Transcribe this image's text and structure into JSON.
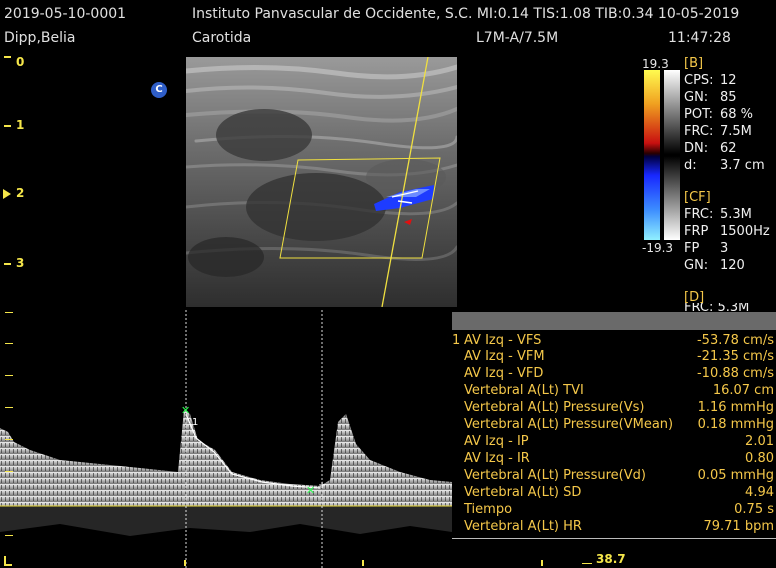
{
  "header": {
    "patient_id": "2019-05-10-0001",
    "institution_info": "Instituto Panvascular de Occidente, S.C. MI:0.14  TIS:1.08  TIB:0.34  10-05-2019",
    "patient_name": "Dipp,Belia",
    "exam": "Carotida",
    "probe": "L7M-A/7.5M",
    "time": "11:47:28"
  },
  "depth_scale": [
    "0",
    "1",
    "2",
    "3"
  ],
  "mode_badge": "C",
  "colorbar": {
    "top": "19.3",
    "bottom": "-19.3"
  },
  "b_params": {
    "title": "[B]",
    "items": [
      {
        "k": "CPS:",
        "v": "12"
      },
      {
        "k": "GN:",
        "v": "85"
      },
      {
        "k": "POT:",
        "v": "68 %"
      },
      {
        "k": "FRC:",
        "v": "7.5M"
      },
      {
        "k": "DN:",
        "v": "62"
      },
      {
        "k": "d:",
        "v": "3.7 cm"
      }
    ]
  },
  "cf_params": {
    "title": "[CF]",
    "items": [
      {
        "k": "FRC:",
        "v": "5.3M"
      },
      {
        "k": "FRP",
        "v": "1500Hz"
      },
      {
        "k": "FP",
        "v": "3"
      },
      {
        "k": "GN:",
        "v": "120"
      }
    ]
  },
  "d_params": {
    "title": "[D]",
    "partial": "FRC: 5.3M"
  },
  "measurements": [
    {
      "num": "1",
      "label": "AV Izq - VFS",
      "value": "-53.78 cm/s"
    },
    {
      "num": "",
      "label": "AV Izq - VFM",
      "value": "-21.35 cm/s"
    },
    {
      "num": "",
      "label": "AV Izq - VFD",
      "value": "-10.88 cm/s"
    },
    {
      "num": "",
      "label": "Vertebral A(Lt) TVI",
      "value": "16.07 cm"
    },
    {
      "num": "",
      "label": "Vertebral A(Lt) Pressure(Vs)",
      "value": "1.16 mmHg"
    },
    {
      "num": "",
      "label": "Vertebral A(Lt) Pressure(VMean)",
      "value": "0.18 mmHg"
    },
    {
      "num": "",
      "label": "AV Izq - IP",
      "value": "2.01"
    },
    {
      "num": "",
      "label": "AV Izq - IR",
      "value": "0.80"
    },
    {
      "num": "",
      "label": "Vertebral A(Lt) Pressure(Vd)",
      "value": "0.05 mmHg"
    },
    {
      "num": "",
      "label": "Vertebral A(Lt) SD",
      "value": "4.94"
    },
    {
      "num": "",
      "label": "Tiempo",
      "value": "0.75 s"
    },
    {
      "num": "",
      "label": "Vertebral A(Lt) HR",
      "value": "79.71 bpm"
    }
  ],
  "sweep_speed": "38.7",
  "colors": {
    "accent": "#f5c84a",
    "scale": "#f5e64a",
    "flow_blue": "#1e3cff",
    "flow_red": "#e01010"
  }
}
